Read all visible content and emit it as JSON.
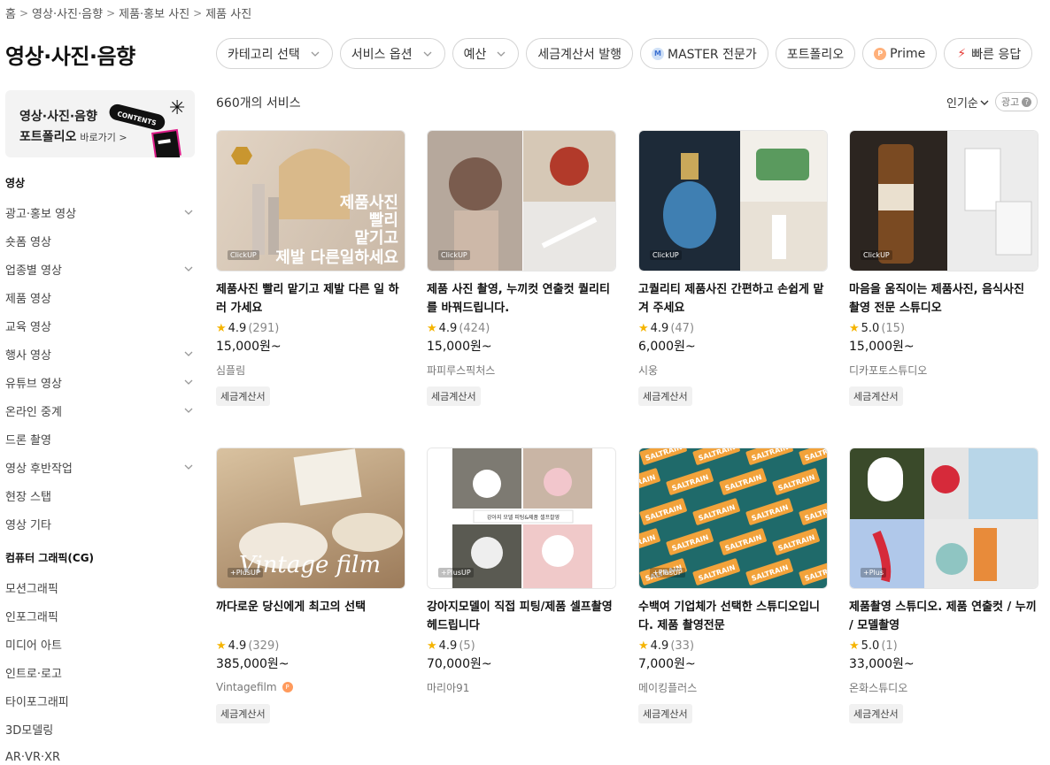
{
  "breadcrumb": [
    "홈",
    "영상·사진·음향",
    "제품·홍보 사진",
    "제품 사진"
  ],
  "page_title": "영상·사진·음향",
  "filters": [
    {
      "label": "카테고리 선택",
      "chevron": true
    },
    {
      "label": "서비스 옵션",
      "chevron": true
    },
    {
      "label": "예산",
      "chevron": true
    },
    {
      "label": "세금계산서 발행",
      "chevron": false
    },
    {
      "label": "MASTER 전문가",
      "chevron": false,
      "dot": "M"
    },
    {
      "label": "포트폴리오",
      "chevron": false
    },
    {
      "label": "Prime",
      "chevron": false,
      "dot": "P"
    },
    {
      "label": "빠른 응답",
      "chevron": false,
      "dot": "⚡"
    }
  ],
  "banner": {
    "line1": "영상·사진·음향",
    "line2": "포트폴리오",
    "link": "바로가기 >",
    "tag": "CONTENTS"
  },
  "sidebar": {
    "sections": [
      {
        "title": "영상",
        "items": [
          {
            "label": "광고·홍보 영상",
            "chevron": true
          },
          {
            "label": "숏폼 영상",
            "chevron": false
          },
          {
            "label": "업종별 영상",
            "chevron": true
          },
          {
            "label": "제품 영상",
            "chevron": false
          },
          {
            "label": "교육 영상",
            "chevron": false
          },
          {
            "label": "행사 영상",
            "chevron": true
          },
          {
            "label": "유튜브 영상",
            "chevron": true
          },
          {
            "label": "온라인 중계",
            "chevron": true
          },
          {
            "label": "드론 촬영",
            "chevron": false
          },
          {
            "label": "영상 후반작업",
            "chevron": true
          },
          {
            "label": "현장 스탭",
            "chevron": false
          },
          {
            "label": "영상 기타",
            "chevron": false
          }
        ]
      },
      {
        "title": "컴퓨터 그래픽(CG)",
        "items": [
          {
            "label": "모션그래픽",
            "chevron": false
          },
          {
            "label": "인포그래픽",
            "chevron": false
          },
          {
            "label": "미디어 아트",
            "chevron": false
          },
          {
            "label": "인트로·로고",
            "chevron": false
          },
          {
            "label": "타이포그래피",
            "chevron": false
          },
          {
            "label": "3D모델링",
            "chevron": false
          },
          {
            "label": "AR·VR·XR",
            "chevron": false
          }
        ]
      }
    ]
  },
  "list": {
    "count": "660개의 서비스",
    "sort": "인기순",
    "ad": "광고"
  },
  "cards": [
    {
      "title": "제품사진 빨리 맡기고 제발 다른 일 하러 가세요",
      "rating": "4.9",
      "reviews": "(291)",
      "price": "15,000원~",
      "seller": "심플림",
      "prime": false,
      "tag": "세금계산서",
      "badge": "ClickUP",
      "overlay": "제품사진\n빨리\n맡기고\n제발 다른일하세요",
      "colors": [
        "#c9b8a6",
        "#e2d4c4"
      ]
    },
    {
      "title": "제품 사진 촬영, 누끼컷 연출컷 퀄리티를 바꿔드립니다.",
      "rating": "4.9",
      "reviews": "(424)",
      "price": "15,000원~",
      "seller": "파피루스픽처스",
      "prime": false,
      "tag": "세금계산서",
      "badge": "ClickUP",
      "overlay": "",
      "colors": [
        "#8a7a70",
        "#b23a2a"
      ]
    },
    {
      "title": "고퀄리티 제품사진 간편하고 손쉽게 맡겨 주세요",
      "rating": "4.9",
      "reviews": "(47)",
      "price": "6,000원~",
      "seller": "시웅",
      "prime": false,
      "tag": "세금계산서",
      "badge": "ClickUP",
      "overlay": "",
      "colors": [
        "#1d2a38",
        "#5a9a5e"
      ]
    },
    {
      "title": "마음을 움직이는 제품사진, 음식사진 촬영 전문 스튜디오",
      "rating": "5.0",
      "reviews": "(15)",
      "price": "15,000원~",
      "seller": "디카포토스튜디오",
      "prime": false,
      "tag": "세금계산서",
      "badge": "ClickUP",
      "overlay": "",
      "colors": [
        "#5a3a22",
        "#dcdcdc"
      ]
    },
    {
      "title": "까다로운 당신에게 최고의 선택",
      "rating": "4.9",
      "reviews": "(329)",
      "price": "385,000원~",
      "seller": "Vintagefilm",
      "prime": true,
      "tag": "세금계산서",
      "badge": "+PlusUP",
      "overlay": "Vintage film",
      "colors": [
        "#9c7b5a",
        "#d9c2a0"
      ]
    },
    {
      "title": "강아지모델이 직접 피팅/제품 셀프촬영 헤드립니다",
      "rating": "4.9",
      "reviews": "(5)",
      "price": "70,000원~",
      "seller": "마리아91",
      "prime": false,
      "tag": "",
      "badge": "+PlusUP",
      "overlay": "강아지 모델 피팅&제품 셀프촬영",
      "colors": [
        "#7d7a72",
        "#f0c9c9"
      ]
    },
    {
      "title": "수백여 기업체가 선택한 스튜디오입니다. 제품 촬영전문",
      "rating": "4.9",
      "reviews": "(33)",
      "price": "7,000원~",
      "seller": "메이킹플러스",
      "prime": false,
      "tag": "세금계산서",
      "badge": "+PlusUP",
      "overlay": "SALTRAIN",
      "colors": [
        "#1f6a6a",
        "#f2a23a"
      ]
    },
    {
      "title": "제품촬영 스튜디오. 제품 연출컷 / 누끼 / 모델촬영",
      "rating": "5.0",
      "reviews": "(1)",
      "price": "33,000원~",
      "seller": "온화스튜디오",
      "prime": false,
      "tag": "세금계산서",
      "badge": "+Plus",
      "overlay": "",
      "colors": [
        "#b8d6e8",
        "#d62a3a"
      ]
    }
  ],
  "theme": {
    "star": "#f5b400",
    "accent": "#111111"
  }
}
